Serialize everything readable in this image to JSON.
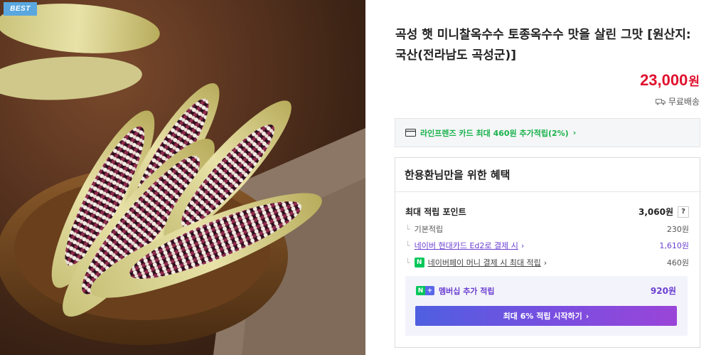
{
  "badge": "BEST",
  "product": {
    "title": "곡성 햇 미니찰옥수수 토종옥수수 맛을 살린 그맛 [원산지:국산(전라남도 곡성군)]",
    "price": "23,000",
    "price_unit": "원",
    "shipping": "무료배송"
  },
  "card_promo": {
    "text": "라인프렌즈 카드 최대 460원 추가적립(2%)",
    "arrow": "›"
  },
  "benefits": {
    "heading": "한용환님만을 위한 혜택",
    "max_points_label": "최대 적립 포인트",
    "max_points_value": "3,060원",
    "help": "?",
    "rows": [
      {
        "label": "기본적립",
        "value": "230원"
      },
      {
        "label": "네이버 현대카드 Ed2로 결제 시",
        "value": "1,610원"
      },
      {
        "label": "네이버페이 머니 결제 시 최대 적립",
        "value": "460원"
      }
    ],
    "member_label": "멤버십 추가 적립",
    "member_value": "920원",
    "cta": "최대 6% 적립 시작하기"
  },
  "icons": {
    "truck": "truck-icon",
    "card": "card-icon",
    "npay": "npay-icon",
    "nplus": "nplus-icon"
  },
  "colors": {
    "price": "#e0112e",
    "accent_green": "#19b24b",
    "accent_purple": "#6b3fd1",
    "badge": "#5aa7e0"
  }
}
